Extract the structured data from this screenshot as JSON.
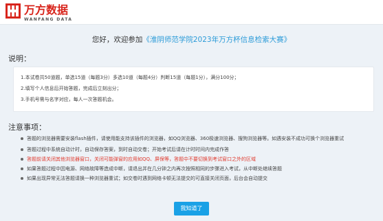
{
  "brand": {
    "name_cn": "万方数据",
    "name_en": "WANFANG DATA",
    "color": "#d8251c"
  },
  "greeting": {
    "prefix": "您好，欢迎参加",
    "contest": "《淮阴师范学院2023年万方杯信息检索大赛》",
    "accent": "#2b9bd8"
  },
  "description": {
    "title": "说明：",
    "lines": [
      "1.本试卷共50道题，单选15道（每题3分）多选10道（每题4分）判断15道（每题1分），满分100分；",
      "2.填写个人信息后开始答题，完成后立刻出分；",
      "3.手机号需与名字对应，每人一次答题机会。"
    ]
  },
  "notices": {
    "title": "注意事项：",
    "items": [
      "答题的浏览器需要安装flash插件，请使用能支持该插件的浏览器，如QQ浏览器、360极速浏览器、搜狗浏览器等。如遇安装不成功可换个浏览器重试",
      "答题过程中系统自动计时，自动保存答案，到时自动交卷；开始考试后请在计时时间内完成作答",
      "答题前请关闭其他浏览器窗口，关闭可能弹窗的应用如QQ、屏保等，答题中不要切换到考试窗口之外的区域",
      "如果答题过程中因电源、网络故障等造成中断，请退出并在几分钟之内再次按照相同的步骤进入考试，从中断处继续答题",
      "如果出现异常无法答题请换一种浏览器重试；如交卷时遇到网络卡顿无法提交的可直接关闭页面，后台会自动提交"
    ],
    "warning_color": "#e03b2f"
  },
  "actions": {
    "ok_label": "我知道了",
    "ok_color": "#1aa1e6"
  }
}
